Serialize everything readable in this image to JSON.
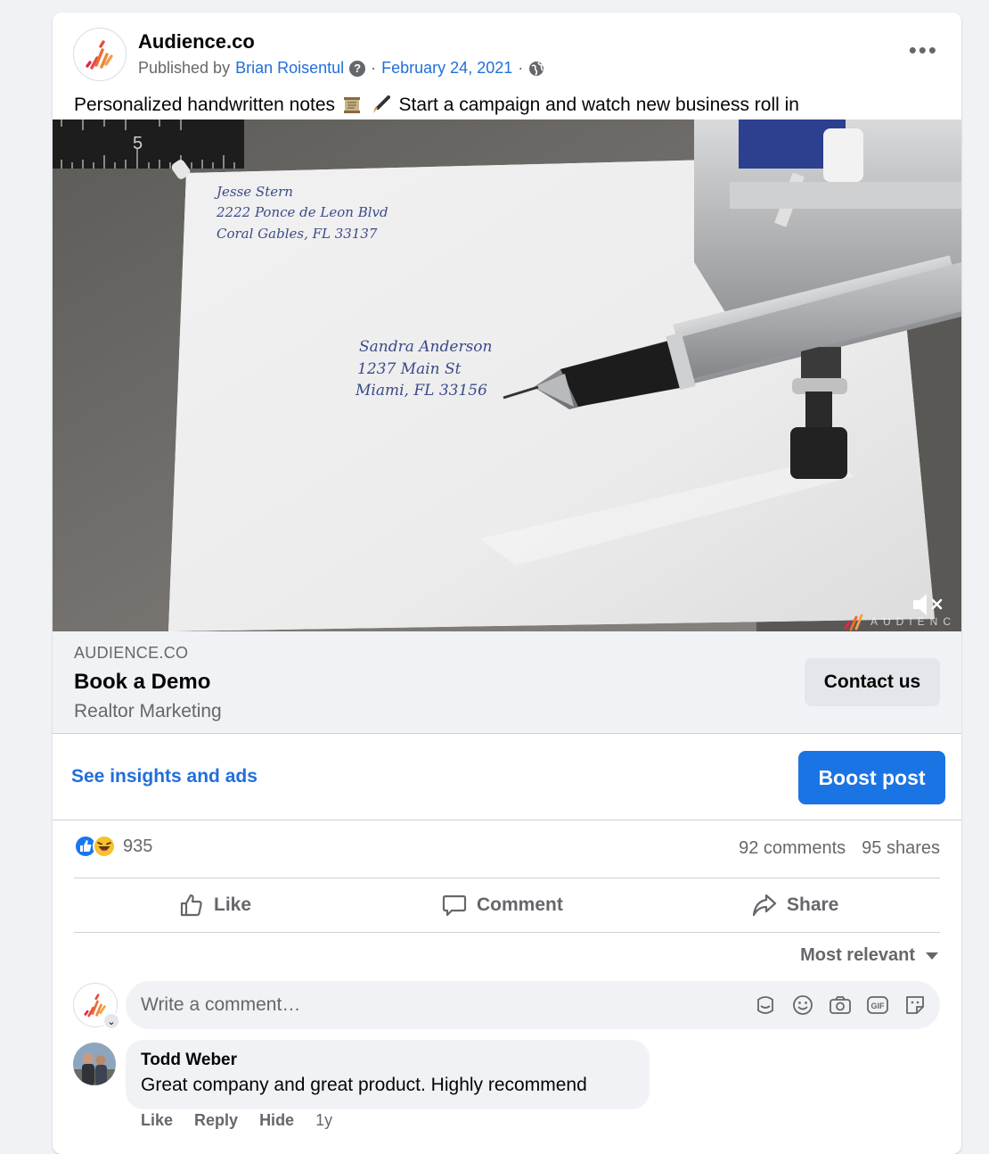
{
  "post": {
    "page_name": "Audience.co",
    "published_by_prefix": "Published by",
    "author": "Brian Roisentul",
    "date": "February 24, 2021",
    "caption_start": "Personalized handwritten notes",
    "caption_end": "Start a campaign and watch new business roll in",
    "caption_emojis": [
      "scroll-emoji",
      "fountain-pen-emoji"
    ]
  },
  "video": {
    "ruler_number": "5",
    "return_address": [
      "Jesse Stern",
      "2222 Ponce de Leon Blvd",
      "Coral Gables, FL 33137"
    ],
    "recipient_address": [
      "Sandra Anderson",
      "1237 Main St",
      "Miami, FL 33156"
    ],
    "watermark": "AUDIENC",
    "mute_icon": "muted-speaker-icon"
  },
  "cta": {
    "domain": "AUDIENCE.CO",
    "title": "Book a Demo",
    "subtitle": "Realtor Marketing",
    "button": "Contact us"
  },
  "insights": {
    "link": "See insights and ads",
    "boost": "Boost post"
  },
  "engagement": {
    "reaction_count": "935",
    "comments": "92 comments",
    "shares": "95 shares"
  },
  "actions": {
    "like": "Like",
    "comment": "Comment",
    "share": "Share"
  },
  "sort": {
    "label": "Most relevant"
  },
  "composer": {
    "placeholder": "Write a comment…"
  },
  "comments": [
    {
      "author": "Todd Weber",
      "text": "Great company and great product. Highly recommend",
      "actions": [
        "Like",
        "Reply",
        "Hide"
      ],
      "age": "1y"
    }
  ],
  "colors": {
    "link": "#216fdb",
    "primary_button": "#1b74e4",
    "muted_text": "#65676b",
    "page_bg": "#f0f2f5"
  }
}
